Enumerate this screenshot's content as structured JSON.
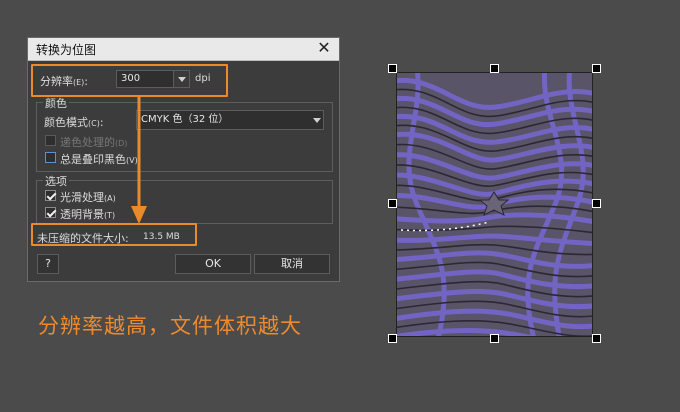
{
  "dialog": {
    "title": "转换为位图",
    "resolution": {
      "label": "分辨率",
      "shortcut": "(E)",
      "suffix": ":",
      "value": "300",
      "unit": "dpi"
    },
    "color_group": {
      "legend": "颜色",
      "mode_label": "颜色模式",
      "mode_shortcut": "(C)",
      "mode_suffix": ":",
      "mode_value": "CMYK 色（32 位）",
      "dither": {
        "label": "递色处理的",
        "shortcut": "(D)",
        "checked": false,
        "enabled": false
      },
      "overprint": {
        "label": "总是叠印黑色",
        "shortcut": "(V)",
        "checked": false,
        "enabled": true
      }
    },
    "options_group": {
      "legend": "选项",
      "antialias": {
        "label": "光滑处理",
        "shortcut": "(A)",
        "checked": true
      },
      "transparent": {
        "label": "透明背景",
        "shortcut": "(T)",
        "checked": true
      }
    },
    "file_size": {
      "label": "未压缩的文件大小:",
      "value": "13.5 MB"
    },
    "buttons": {
      "help": "?",
      "ok": "OK",
      "cancel": "取消"
    }
  },
  "caption": "分辨率越高，文件体积越大",
  "colors": {
    "highlight": "#e98a2b",
    "artwork_fill": "#6e62b8",
    "artwork_stroke": "#2b2733"
  },
  "icons": {
    "close": "close-icon",
    "dropdown": "chevron-down-icon",
    "arrow": "arrow-down-icon"
  }
}
